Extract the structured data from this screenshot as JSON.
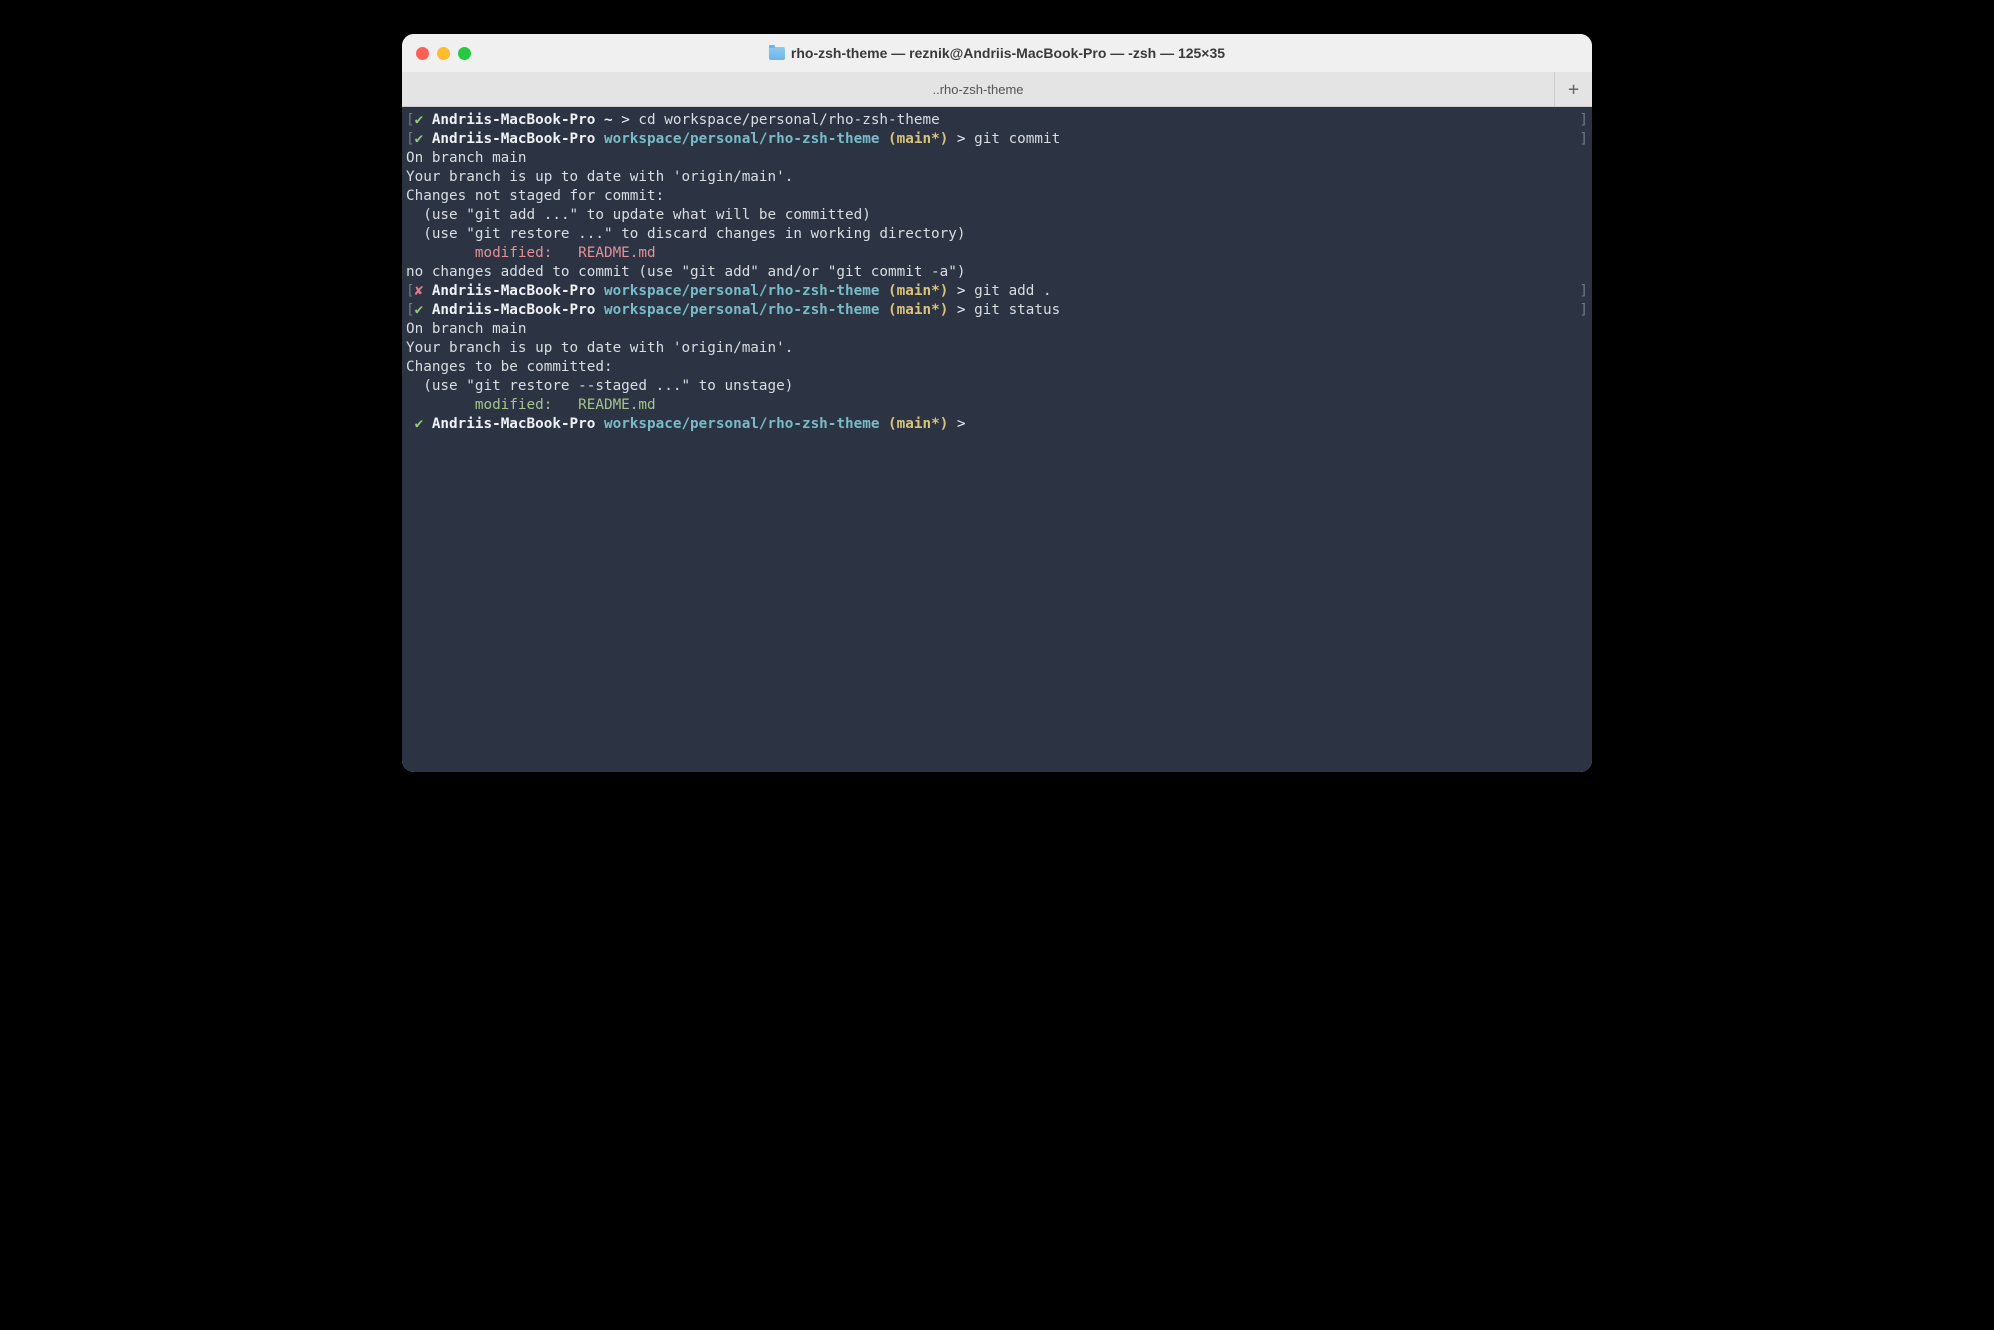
{
  "window": {
    "title": "rho-zsh-theme — reznik@Andriis-MacBook-Pro — -zsh — 125×35",
    "tab_title": "..rho-zsh-theme"
  },
  "host": "Andriis-MacBook-Pro",
  "lines": [
    {
      "type": "prompt",
      "status": "ok",
      "path": "~",
      "branch": "",
      "cmd": "cd workspace/personal/rho-zsh-theme"
    },
    {
      "type": "prompt",
      "status": "ok",
      "path": "workspace/personal/rho-zsh-theme",
      "branch": "main*",
      "cmd": "git commit"
    },
    {
      "type": "out",
      "text": "On branch main"
    },
    {
      "type": "out",
      "text": "Your branch is up to date with 'origin/main'."
    },
    {
      "type": "blank"
    },
    {
      "type": "out",
      "text": "Changes not staged for commit:"
    },
    {
      "type": "out",
      "text": "  (use \"git add <file>...\" to update what will be committed)"
    },
    {
      "type": "out",
      "text": "  (use \"git restore <file>...\" to discard changes in working directory)"
    },
    {
      "type": "color",
      "cls": "red",
      "text": "        modified:   README.md"
    },
    {
      "type": "blank"
    },
    {
      "type": "out",
      "text": "no changes added to commit (use \"git add\" and/or \"git commit -a\")"
    },
    {
      "type": "prompt",
      "status": "fail",
      "path": "workspace/personal/rho-zsh-theme",
      "branch": "main*",
      "cmd": "git add ."
    },
    {
      "type": "prompt",
      "status": "ok",
      "path": "workspace/personal/rho-zsh-theme",
      "branch": "main*",
      "cmd": "git status"
    },
    {
      "type": "out",
      "text": "On branch main"
    },
    {
      "type": "out",
      "text": "Your branch is up to date with 'origin/main'."
    },
    {
      "type": "blank"
    },
    {
      "type": "out",
      "text": "Changes to be committed:"
    },
    {
      "type": "out",
      "text": "  (use \"git restore --staged <file>...\" to unstage)"
    },
    {
      "type": "color",
      "cls": "green",
      "text": "        modified:   README.md"
    },
    {
      "type": "blank"
    },
    {
      "type": "prompt_open",
      "status": "ok",
      "path": "workspace/personal/rho-zsh-theme",
      "branch": "main*",
      "cmd": ""
    }
  ]
}
